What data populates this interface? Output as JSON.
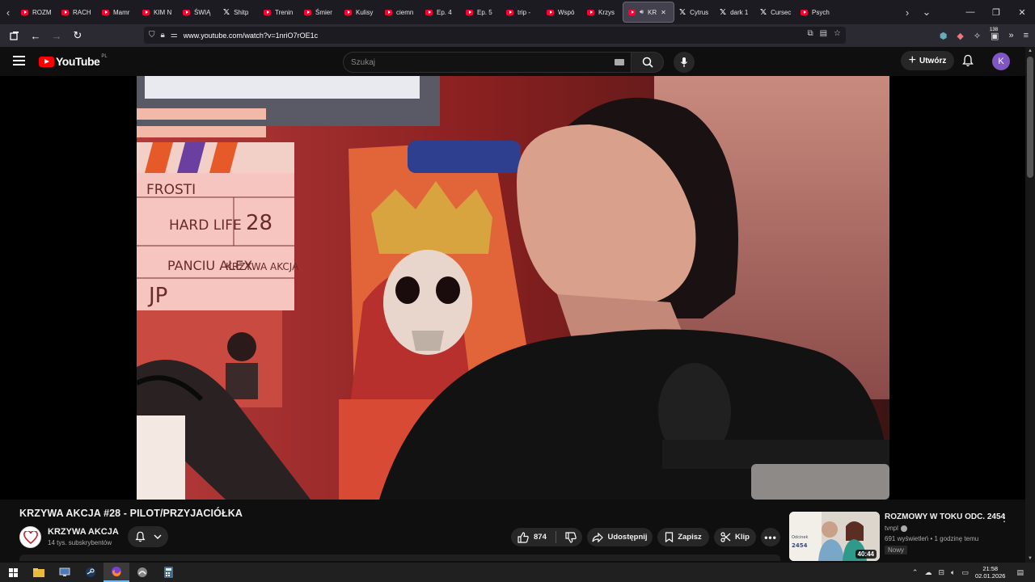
{
  "browser": {
    "tabs": [
      {
        "label": "ROZM",
        "icon": "youtube"
      },
      {
        "label": "RACH",
        "icon": "youtube"
      },
      {
        "label": "Mamr",
        "icon": "youtube"
      },
      {
        "label": "KIM N",
        "icon": "youtube"
      },
      {
        "label": "ŚWIĄ",
        "icon": "youtube"
      },
      {
        "label": "Shitp",
        "icon": "x"
      },
      {
        "label": "Trenin",
        "icon": "youtube"
      },
      {
        "label": "Śmier",
        "icon": "youtube"
      },
      {
        "label": "Kulisy",
        "icon": "youtube"
      },
      {
        "label": "ciemn",
        "icon": "youtube"
      },
      {
        "label": "Ep. 4",
        "icon": "youtube"
      },
      {
        "label": "Ep. 5",
        "icon": "youtube"
      },
      {
        "label": "trip -",
        "icon": "youtube"
      },
      {
        "label": "Wspó",
        "icon": "youtube"
      },
      {
        "label": "Krzys",
        "icon": "youtube"
      },
      {
        "label": "KR",
        "icon": "youtube",
        "active": true
      },
      {
        "label": "Cytrus",
        "icon": "x"
      },
      {
        "label": "dark 1",
        "icon": "x"
      },
      {
        "label": "Cursec",
        "icon": "x"
      },
      {
        "label": "Psych",
        "icon": "youtube"
      }
    ],
    "url": "www.youtube.com/watch?v=1nriO7rOE1c",
    "extension_badge": "138"
  },
  "youtube": {
    "logo_text": "YouTube",
    "country_code": "PL",
    "search_placeholder": "Szukaj",
    "create_label": "Utwórz",
    "avatar_letter": "K"
  },
  "video": {
    "title": "KRZYWA AKCJA #28 - PILOT/PRZYJACIÓŁKA",
    "channel_name": "KRZYWA AKCJA",
    "subscribers": "14 tys. subskrybentów",
    "likes": "874",
    "share_label": "Udostępnij",
    "save_label": "Zapisz",
    "clip_label": "Klip",
    "scene_text": {
      "board_title": "FROSTI",
      "board_scene": "HARD LIFE",
      "board_number": "28",
      "board_director": "PANCIU ALEX",
      "board_camera": "KRZYWA AKCJA",
      "board_jp": "JP"
    }
  },
  "recommendation": {
    "title": "ROZMOWY W TOKU ODC. 2454",
    "channel": "tvnpl",
    "meta": "691 wyświetleń • 1 godzinę temu",
    "badge": "Nowy",
    "duration": "40:44",
    "thumb_label": "Odcinek",
    "thumb_number": "2454"
  },
  "taskbar": {
    "time": "21:58",
    "date": "02.01.2026"
  },
  "colors": {
    "yt_red": "#ff0000",
    "avatar": "#7e57c2",
    "background": "#0f0f0f"
  }
}
